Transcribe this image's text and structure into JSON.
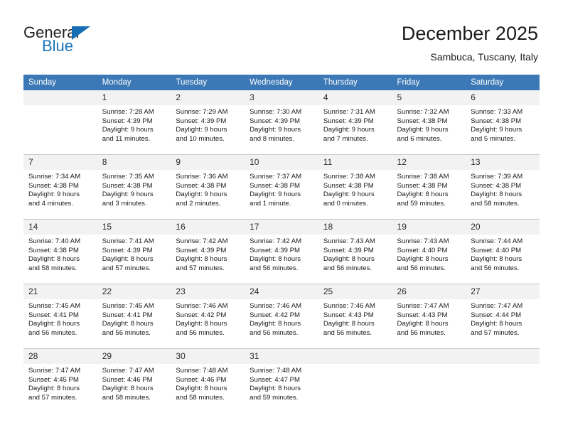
{
  "brand": {
    "name_top": "General",
    "name_bottom": "Blue",
    "accent_color": "#1a75bb"
  },
  "header": {
    "title": "December 2025",
    "subtitle": "Sambuca, Tuscany, Italy"
  },
  "calendar": {
    "header_bg": "#3b78b5",
    "daynum_bg": "#f2f2f2",
    "weekdays": [
      "Sunday",
      "Monday",
      "Tuesday",
      "Wednesday",
      "Thursday",
      "Friday",
      "Saturday"
    ],
    "labels": {
      "sunrise": "Sunrise:",
      "sunset": "Sunset:",
      "daylight": "Daylight:"
    },
    "weeks": [
      [
        {
          "day": "",
          "blank": true
        },
        {
          "day": "1",
          "sunrise": "Sunrise: 7:28 AM",
          "sunset": "Sunset: 4:39 PM",
          "daylight_1": "Daylight: 9 hours",
          "daylight_2": "and 11 minutes."
        },
        {
          "day": "2",
          "sunrise": "Sunrise: 7:29 AM",
          "sunset": "Sunset: 4:39 PM",
          "daylight_1": "Daylight: 9 hours",
          "daylight_2": "and 10 minutes."
        },
        {
          "day": "3",
          "sunrise": "Sunrise: 7:30 AM",
          "sunset": "Sunset: 4:39 PM",
          "daylight_1": "Daylight: 9 hours",
          "daylight_2": "and 8 minutes."
        },
        {
          "day": "4",
          "sunrise": "Sunrise: 7:31 AM",
          "sunset": "Sunset: 4:39 PM",
          "daylight_1": "Daylight: 9 hours",
          "daylight_2": "and 7 minutes."
        },
        {
          "day": "5",
          "sunrise": "Sunrise: 7:32 AM",
          "sunset": "Sunset: 4:38 PM",
          "daylight_1": "Daylight: 9 hours",
          "daylight_2": "and 6 minutes."
        },
        {
          "day": "6",
          "sunrise": "Sunrise: 7:33 AM",
          "sunset": "Sunset: 4:38 PM",
          "daylight_1": "Daylight: 9 hours",
          "daylight_2": "and 5 minutes."
        }
      ],
      [
        {
          "day": "7",
          "sunrise": "Sunrise: 7:34 AM",
          "sunset": "Sunset: 4:38 PM",
          "daylight_1": "Daylight: 9 hours",
          "daylight_2": "and 4 minutes."
        },
        {
          "day": "8",
          "sunrise": "Sunrise: 7:35 AM",
          "sunset": "Sunset: 4:38 PM",
          "daylight_1": "Daylight: 9 hours",
          "daylight_2": "and 3 minutes."
        },
        {
          "day": "9",
          "sunrise": "Sunrise: 7:36 AM",
          "sunset": "Sunset: 4:38 PM",
          "daylight_1": "Daylight: 9 hours",
          "daylight_2": "and 2 minutes."
        },
        {
          "day": "10",
          "sunrise": "Sunrise: 7:37 AM",
          "sunset": "Sunset: 4:38 PM",
          "daylight_1": "Daylight: 9 hours",
          "daylight_2": "and 1 minute."
        },
        {
          "day": "11",
          "sunrise": "Sunrise: 7:38 AM",
          "sunset": "Sunset: 4:38 PM",
          "daylight_1": "Daylight: 9 hours",
          "daylight_2": "and 0 minutes."
        },
        {
          "day": "12",
          "sunrise": "Sunrise: 7:38 AM",
          "sunset": "Sunset: 4:38 PM",
          "daylight_1": "Daylight: 8 hours",
          "daylight_2": "and 59 minutes."
        },
        {
          "day": "13",
          "sunrise": "Sunrise: 7:39 AM",
          "sunset": "Sunset: 4:38 PM",
          "daylight_1": "Daylight: 8 hours",
          "daylight_2": "and 58 minutes."
        }
      ],
      [
        {
          "day": "14",
          "sunrise": "Sunrise: 7:40 AM",
          "sunset": "Sunset: 4:38 PM",
          "daylight_1": "Daylight: 8 hours",
          "daylight_2": "and 58 minutes."
        },
        {
          "day": "15",
          "sunrise": "Sunrise: 7:41 AM",
          "sunset": "Sunset: 4:39 PM",
          "daylight_1": "Daylight: 8 hours",
          "daylight_2": "and 57 minutes."
        },
        {
          "day": "16",
          "sunrise": "Sunrise: 7:42 AM",
          "sunset": "Sunset: 4:39 PM",
          "daylight_1": "Daylight: 8 hours",
          "daylight_2": "and 57 minutes."
        },
        {
          "day": "17",
          "sunrise": "Sunrise: 7:42 AM",
          "sunset": "Sunset: 4:39 PM",
          "daylight_1": "Daylight: 8 hours",
          "daylight_2": "and 56 minutes."
        },
        {
          "day": "18",
          "sunrise": "Sunrise: 7:43 AM",
          "sunset": "Sunset: 4:39 PM",
          "daylight_1": "Daylight: 8 hours",
          "daylight_2": "and 56 minutes."
        },
        {
          "day": "19",
          "sunrise": "Sunrise: 7:43 AM",
          "sunset": "Sunset: 4:40 PM",
          "daylight_1": "Daylight: 8 hours",
          "daylight_2": "and 56 minutes."
        },
        {
          "day": "20",
          "sunrise": "Sunrise: 7:44 AM",
          "sunset": "Sunset: 4:40 PM",
          "daylight_1": "Daylight: 8 hours",
          "daylight_2": "and 56 minutes."
        }
      ],
      [
        {
          "day": "21",
          "sunrise": "Sunrise: 7:45 AM",
          "sunset": "Sunset: 4:41 PM",
          "daylight_1": "Daylight: 8 hours",
          "daylight_2": "and 56 minutes."
        },
        {
          "day": "22",
          "sunrise": "Sunrise: 7:45 AM",
          "sunset": "Sunset: 4:41 PM",
          "daylight_1": "Daylight: 8 hours",
          "daylight_2": "and 56 minutes."
        },
        {
          "day": "23",
          "sunrise": "Sunrise: 7:46 AM",
          "sunset": "Sunset: 4:42 PM",
          "daylight_1": "Daylight: 8 hours",
          "daylight_2": "and 56 minutes."
        },
        {
          "day": "24",
          "sunrise": "Sunrise: 7:46 AM",
          "sunset": "Sunset: 4:42 PM",
          "daylight_1": "Daylight: 8 hours",
          "daylight_2": "and 56 minutes."
        },
        {
          "day": "25",
          "sunrise": "Sunrise: 7:46 AM",
          "sunset": "Sunset: 4:43 PM",
          "daylight_1": "Daylight: 8 hours",
          "daylight_2": "and 56 minutes."
        },
        {
          "day": "26",
          "sunrise": "Sunrise: 7:47 AM",
          "sunset": "Sunset: 4:43 PM",
          "daylight_1": "Daylight: 8 hours",
          "daylight_2": "and 56 minutes."
        },
        {
          "day": "27",
          "sunrise": "Sunrise: 7:47 AM",
          "sunset": "Sunset: 4:44 PM",
          "daylight_1": "Daylight: 8 hours",
          "daylight_2": "and 57 minutes."
        }
      ],
      [
        {
          "day": "28",
          "sunrise": "Sunrise: 7:47 AM",
          "sunset": "Sunset: 4:45 PM",
          "daylight_1": "Daylight: 8 hours",
          "daylight_2": "and 57 minutes."
        },
        {
          "day": "29",
          "sunrise": "Sunrise: 7:47 AM",
          "sunset": "Sunset: 4:46 PM",
          "daylight_1": "Daylight: 8 hours",
          "daylight_2": "and 58 minutes."
        },
        {
          "day": "30",
          "sunrise": "Sunrise: 7:48 AM",
          "sunset": "Sunset: 4:46 PM",
          "daylight_1": "Daylight: 8 hours",
          "daylight_2": "and 58 minutes."
        },
        {
          "day": "31",
          "sunrise": "Sunrise: 7:48 AM",
          "sunset": "Sunset: 4:47 PM",
          "daylight_1": "Daylight: 8 hours",
          "daylight_2": "and 59 minutes."
        },
        {
          "day": "",
          "blank": true
        },
        {
          "day": "",
          "blank": true
        },
        {
          "day": "",
          "blank": true
        }
      ]
    ]
  }
}
